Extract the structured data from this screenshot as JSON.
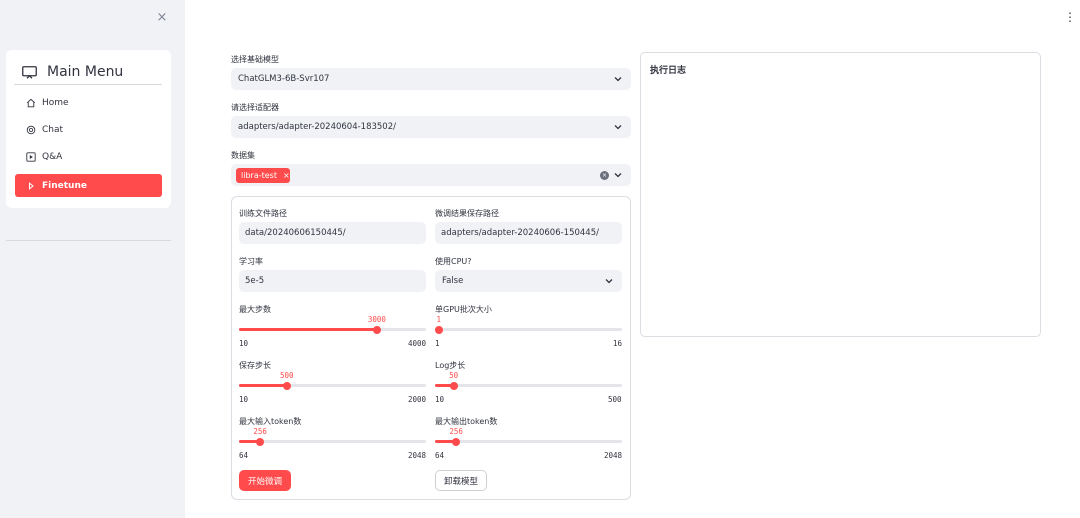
{
  "sidebar": {
    "close_icon": "×",
    "menu_title": "Main Menu",
    "items": [
      {
        "label": "Home",
        "icon": "house-icon",
        "active": false
      },
      {
        "label": "Chat",
        "icon": "chat-icon",
        "active": false
      },
      {
        "label": "Q&A",
        "icon": "play-box-icon",
        "active": false
      },
      {
        "label": "Finetune",
        "icon": "caret-right-icon",
        "active": true
      }
    ]
  },
  "top_menu_icon": "⋮",
  "form": {
    "base_model": {
      "label": "选择基础模型",
      "value": "ChatGLM3-6B-Svr107"
    },
    "adapter": {
      "label": "请选择适配器",
      "value": "adapters/adapter-20240604-183502/"
    },
    "dataset": {
      "label": "数据集",
      "tags": [
        "libra-test"
      ],
      "tag_close": "×",
      "clear_icon": "×"
    },
    "train_path": {
      "label": "训练文件路径",
      "value": "data/20240606150445/"
    },
    "save_path": {
      "label": "微调结果保存路径",
      "value": "adapters/adapter-20240606-150445/"
    },
    "learning_rate": {
      "label": "学习率",
      "value": "5e-5"
    },
    "use_cpu": {
      "label": "使用CPU?",
      "value": "False"
    },
    "max_steps": {
      "label": "最大步数",
      "value": "3000",
      "min": "10",
      "max": "4000",
      "fraction": 0.748
    },
    "per_gpu_batch": {
      "label": "单GPU批次大小",
      "value": "1",
      "min": "1",
      "max": "16",
      "fraction": 0.0
    },
    "save_steps": {
      "label": "保存步长",
      "value": "500",
      "min": "10",
      "max": "2000",
      "fraction": 0.246
    },
    "log_steps": {
      "label": "Log步长",
      "value": "50",
      "min": "10",
      "max": "500",
      "fraction": 0.082
    },
    "max_input_tokens": {
      "label": "最大输入token数",
      "value": "256",
      "min": "64",
      "max": "2048",
      "fraction": 0.097
    },
    "max_output_tokens": {
      "label": "最大输出token数",
      "value": "256",
      "min": "64",
      "max": "2048",
      "fraction": 0.097
    },
    "start_button": "开始微调",
    "unload_button": "卸载模型"
  },
  "log": {
    "title": "执行日志"
  },
  "colors": {
    "accent": "#ff4b4b",
    "sidebar_bg": "#f0f2f6",
    "input_bg": "#f0f2f6"
  }
}
